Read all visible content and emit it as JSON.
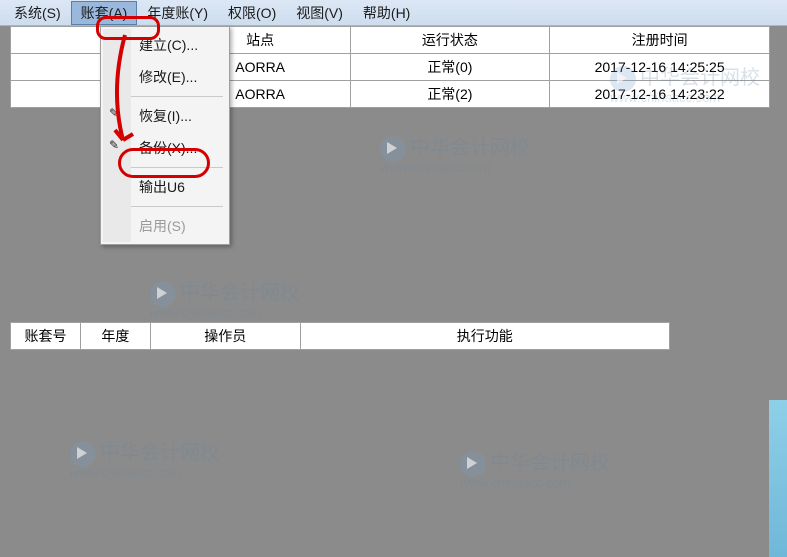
{
  "menubar": {
    "system": "系统(S)",
    "account": "账套(A)",
    "year": "年度账(Y)",
    "permission": "权限(O)",
    "view": "视图(V)",
    "help": "帮助(H)"
  },
  "dropdown": {
    "create": "建立(C)...",
    "modify": "修改(E)...",
    "restore": "恢复(I)...",
    "backup": "备份(X)...",
    "export": "输出U6",
    "enable": "启用(S)"
  },
  "table": {
    "headers": {
      "site": "站点",
      "status": "运行状态",
      "regtime": "注册时间"
    },
    "rows": [
      {
        "site": "AORRA",
        "status": "正常(0)",
        "regtime": "2017-12-16 14:25:25"
      },
      {
        "site": "AORRA",
        "status": "正常(2)",
        "regtime": "2017-12-16 14:23:22"
      }
    ]
  },
  "tasktable": {
    "headers": {
      "acct": "账套号",
      "year": "年度",
      "operator": "操作员",
      "func": "执行功能"
    }
  },
  "watermark": {
    "text": "中华会计网校",
    "sub": "www.chinaacc.com"
  }
}
